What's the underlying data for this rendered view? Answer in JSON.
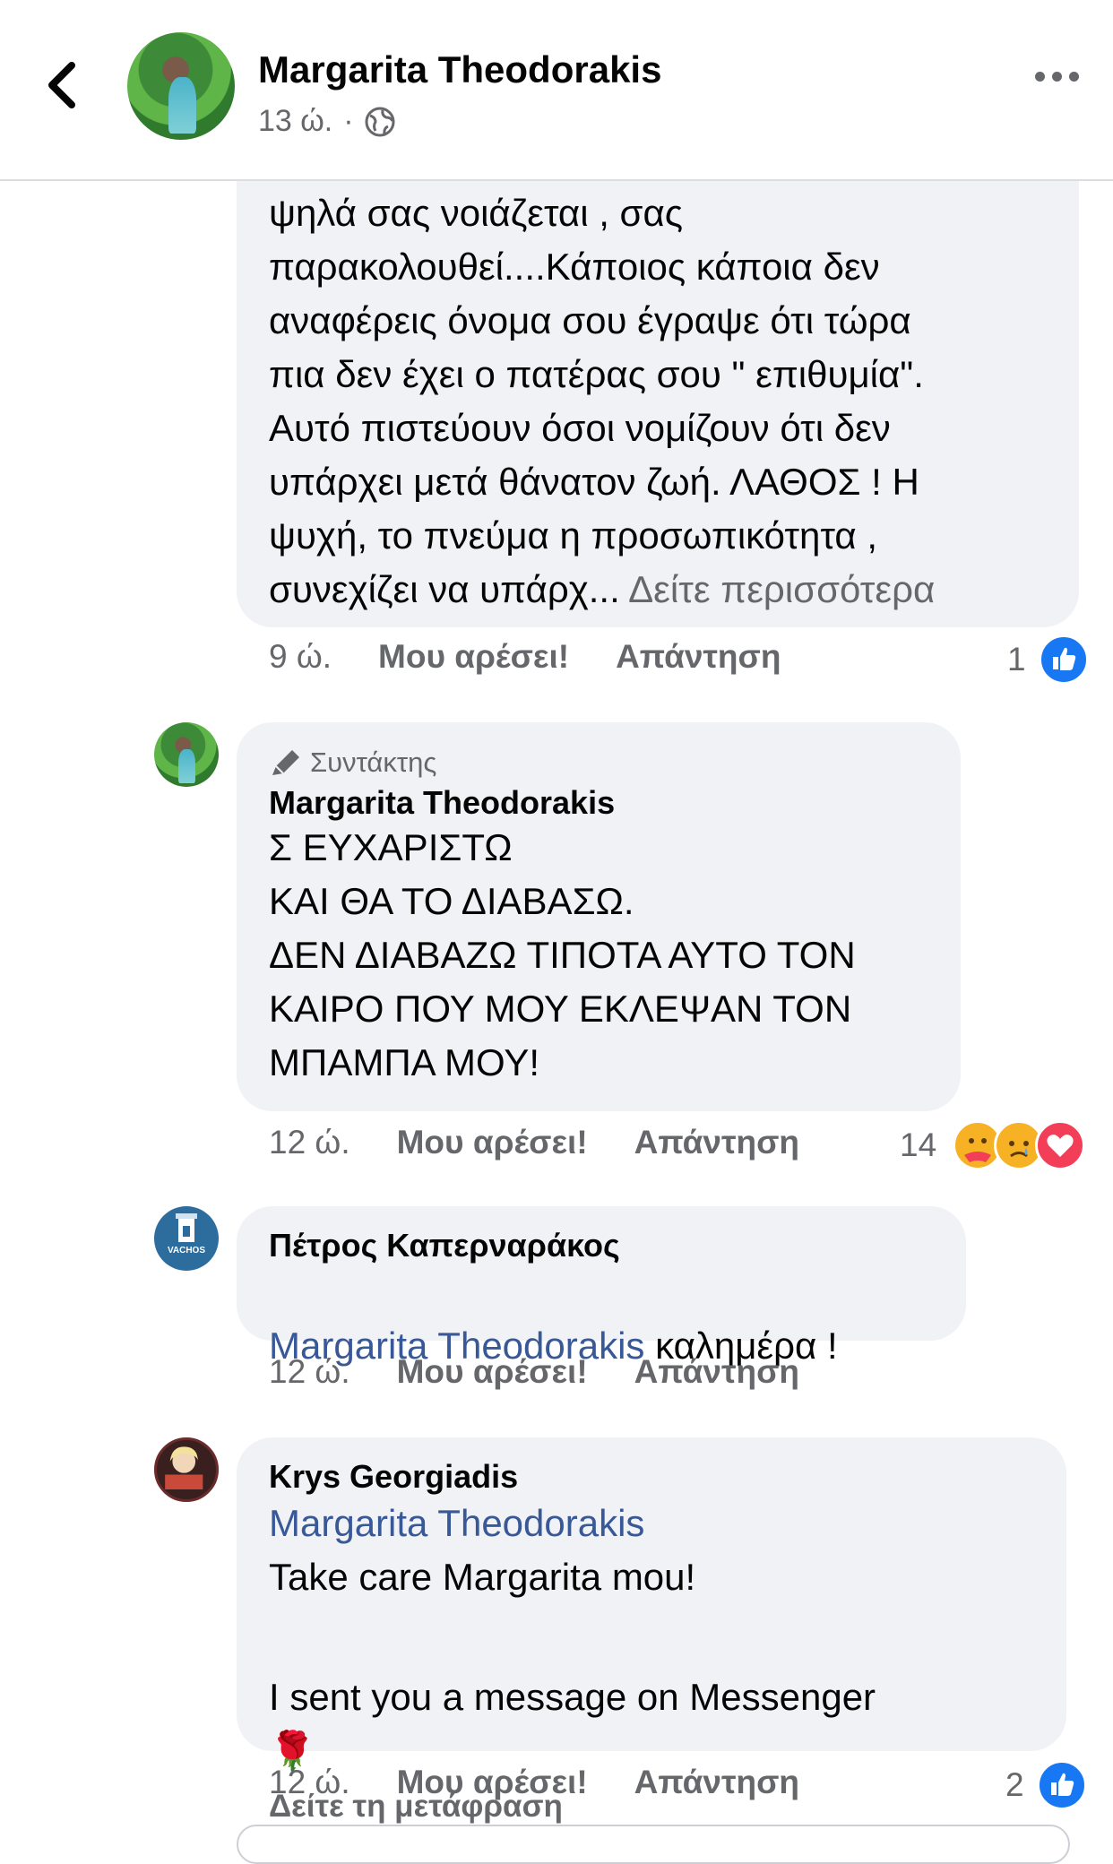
{
  "header": {
    "author": "Margarita Theodorakis",
    "time": "13 ώ.",
    "separator": "·"
  },
  "comments": [
    {
      "text": "ψηλά σας νοιάζεται , σας\nπαρακολουθεί....Κάποιος κάποια δεν\nαναφέρεις όνομα σου έγραψε ότι τώρα\nπια δεν έχει ο πατέρας σου \" επιθυμία\".\nΑυτό πιστεύουν όσοι νομίζουν ότι δεν\nυπάρχει μετά θάνατον ζωή. ΛΑΘΟΣ ! Η\nψυχή, το πνεύμα η προσωπικότητα ,\nσυνεχίζει να υπάρχ...",
      "see_more": "Δείτε περισσότερα",
      "time": "9 ώ.",
      "like": "Μου αρέσει!",
      "reply": "Απάντηση",
      "reactions": "1"
    },
    {
      "badge": "Συντάκτης",
      "name": "Margarita Theodorakis",
      "text": "Σ ΕΥΧΑΡΙΣΤΩ\nΚΑΙ ΘΑ ΤΟ ΔΙΑΒΑΣΩ.\nΔΕΝ ΔΙΑΒΑΖΩ ΤΙΠΟΤΑ ΑΥΤΟ ΤΟΝ\nΚΑΙΡΟ ΠΟΥ ΜΟΥ ΕΚΛΕΨΑΝ ΤΟΝ\nΜΠΑΜΠΑ ΜΟΥ!",
      "time": "12 ώ.",
      "like": "Μου αρέσει!",
      "reply": "Απάντηση",
      "reactions": "14"
    },
    {
      "name": "Πέτρος Καπερναράκος",
      "avatar_text": "VACHOS",
      "mention": "Margarita Theodorakis",
      "text": " καλημέρα !",
      "time": "12 ώ.",
      "like": "Μου αρέσει!",
      "reply": "Απάντηση"
    },
    {
      "name": "Krys Georgiadis",
      "mention": "Margarita Theodorakis",
      "line1": "Take care Margarita mou!",
      "line2": "I sent you a message on Messenger",
      "emoji": "🌹",
      "translate": "Δείτε τη μετάφραση",
      "time": "12 ώ.",
      "like": "Μου αρέσει!",
      "reply": "Απάντηση",
      "reactions": "2"
    }
  ]
}
